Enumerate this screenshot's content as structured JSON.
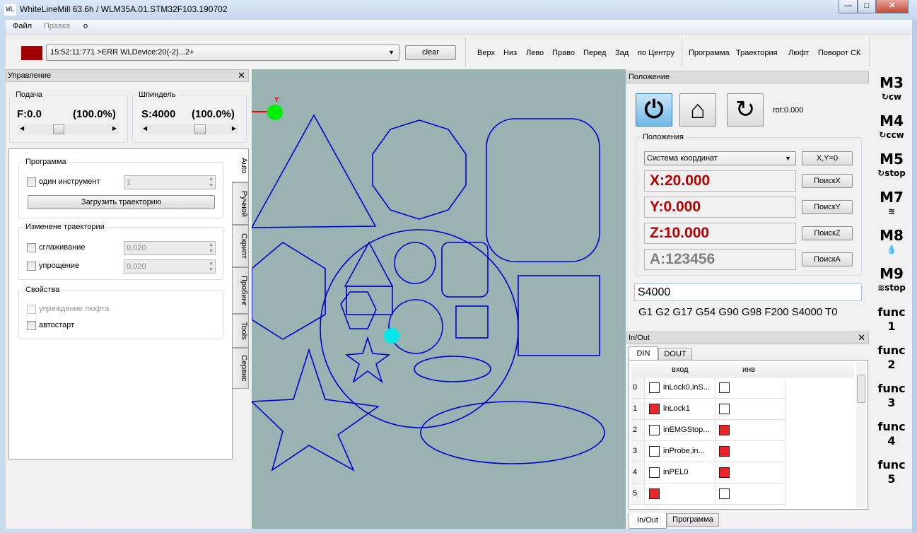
{
  "window": {
    "title": "WhiteLineMill 63.6h / WLM35A.01.STM32F103.190702",
    "logo": "WL",
    "controls": [
      "minimize",
      "maximize",
      "close"
    ]
  },
  "menu": [
    "Файл",
    "Правка",
    "о"
  ],
  "toolbar": {
    "status_color": "#a00000",
    "log": "15:52:11:771 >ERR WLDevice:20(-2)...2+",
    "clear": "clear",
    "views": [
      "Верх",
      "Низ",
      "Лево",
      "Право",
      "Перед",
      "Зад",
      "по Центру"
    ],
    "show": [
      "Программа",
      "Траектория",
      "Люфт",
      "Поворот СК"
    ]
  },
  "control": {
    "title": "Управление",
    "feed": {
      "label": "Подача",
      "value": "F:0.0",
      "percent": "(100.0%)",
      "slider": 0.5
    },
    "spindle": {
      "label": "Шпиндель",
      "value": "S:4000",
      "percent": "(100.0%)",
      "slider": 0.5
    },
    "program": {
      "label": "Программа",
      "one_tool": "один инструмент",
      "tool_value": "1",
      "load": "Загрузить траекторию"
    },
    "trajectory": {
      "label": "Изменене траектории",
      "smoothing": "сглаживание",
      "smoothing_value": "0,020",
      "simplify": "упрощение",
      "simplify_value": "0,020"
    },
    "props": {
      "label": "Свойства",
      "backlash": "упреждение люфта",
      "autostart": "автостарт"
    },
    "tabs": [
      "Auto",
      "Ручной",
      "Скрипт",
      "Пробинг",
      "Tools",
      "Сервис"
    ],
    "active_tab": "Auto"
  },
  "position": {
    "title": "Положение",
    "rot": "rot:0.000",
    "group": "Положения",
    "cs": "Система координат",
    "xy0": "X,Y=0",
    "axes": [
      {
        "value": "X:20.000",
        "search": "ПоискX",
        "color": "#b00000"
      },
      {
        "value": "Y:0.000",
        "search": "ПоискY",
        "color": "#b00000"
      },
      {
        "value": "Z:10.000",
        "search": "ПоискZ",
        "color": "#b00000"
      },
      {
        "value": "A:123456",
        "search": "ПоискA",
        "color": "#808080"
      }
    ],
    "command": "S4000",
    "modal": "G1 G2 G17 G54 G90 G98 F200 S4000 T0"
  },
  "io": {
    "title": "In/Out",
    "tabs": [
      "DIN",
      "DOUT"
    ],
    "headers": [
      "вход",
      "инв"
    ],
    "rows": [
      {
        "n": "0",
        "on": false,
        "name": "inLock0,inS...",
        "inv": false
      },
      {
        "n": "1",
        "on": true,
        "name": "inLock1",
        "inv": false
      },
      {
        "n": "2",
        "on": false,
        "name": "inEMGStop...",
        "inv": true
      },
      {
        "n": "3",
        "on": false,
        "name": "inProbe,in...",
        "inv": true
      },
      {
        "n": "4",
        "on": false,
        "name": "inPEL0",
        "inv": true
      },
      {
        "n": "5",
        "on": true,
        "name": "",
        "inv": false
      }
    ],
    "bottom_tabs": [
      "In/Out",
      "Программа"
    ]
  },
  "mcodes": [
    {
      "code": "M3",
      "sub": "cw"
    },
    {
      "code": "M4",
      "sub": "ccw"
    },
    {
      "code": "M5",
      "sub": "stop"
    },
    {
      "code": "M7",
      "sub": ""
    },
    {
      "code": "M8",
      "sub": ""
    },
    {
      "code": "M9",
      "sub": "stop"
    }
  ],
  "funcs": [
    "func 1",
    "func 2",
    "func 3",
    "func 4",
    "func 5"
  ],
  "canvas": {
    "background": "#99b3b3",
    "path_color": "#0000cc",
    "axis_label": "Y"
  }
}
